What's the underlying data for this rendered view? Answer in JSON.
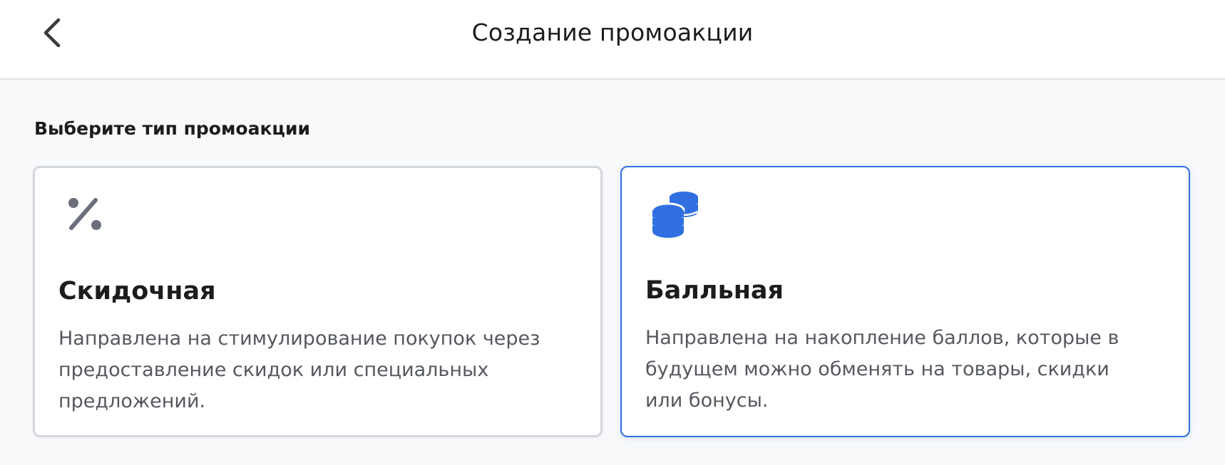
{
  "header": {
    "title": "Создание промоакции"
  },
  "section": {
    "title": "Выберите тип промоакции"
  },
  "cards": [
    {
      "icon": "percent-icon",
      "title": "Скидочная",
      "description": "Направлена на стимулирование покупок через предоставление скидок или специальных предложений.",
      "selected": false
    },
    {
      "icon": "coins-icon",
      "title": "Балльная",
      "description": "Направлена на накопление баллов, которые в будущем можно обменять на товары, скидки или бонусы.",
      "selected": true
    }
  ],
  "colors": {
    "accent": "#2f6fe0",
    "icon_gray": "#6b6f7c",
    "text_secondary": "#55585f"
  }
}
